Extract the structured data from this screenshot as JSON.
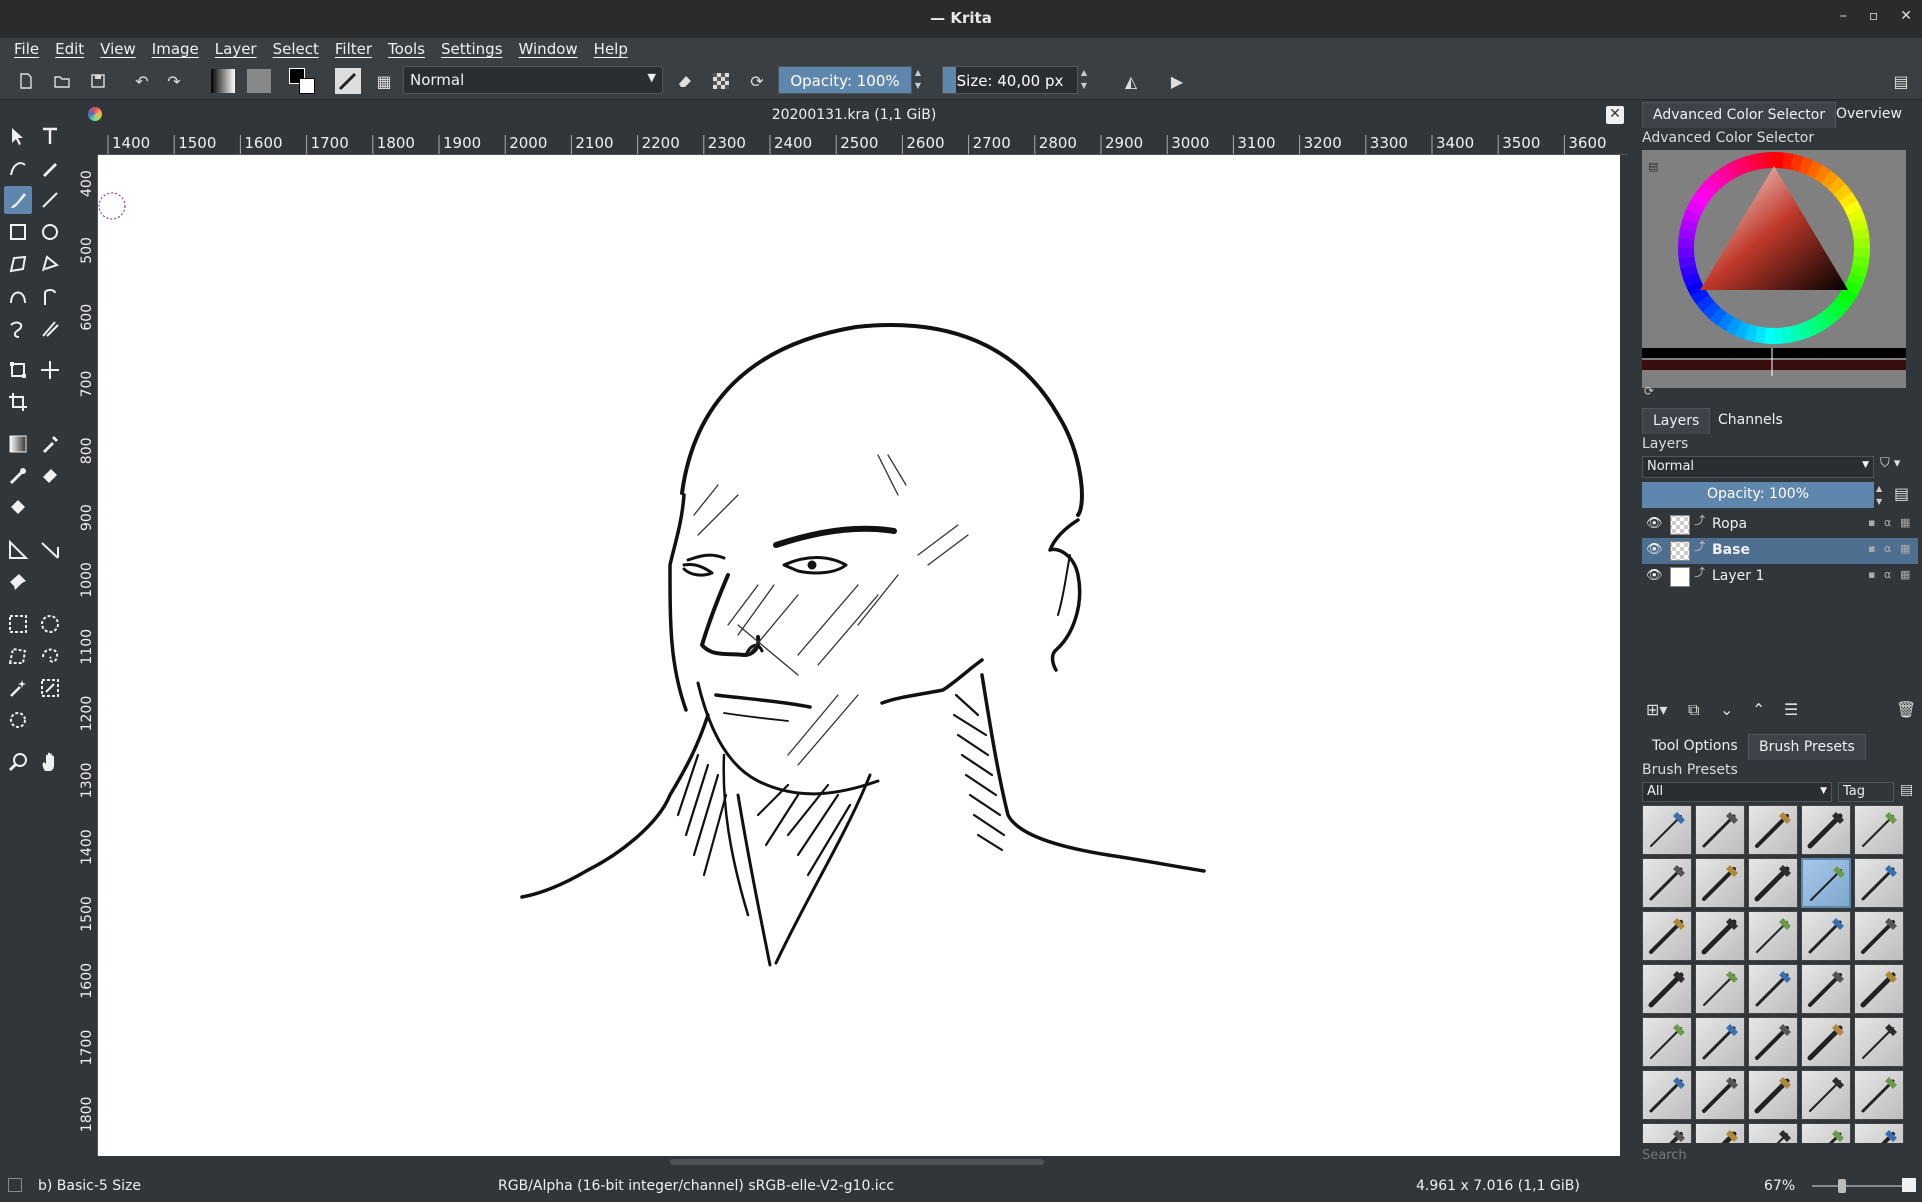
{
  "window": {
    "title": "— Krita"
  },
  "menu": [
    "File",
    "Edit",
    "View",
    "Image",
    "Layer",
    "Select",
    "Filter",
    "Tools",
    "Settings",
    "Window",
    "Help"
  ],
  "toolbar": {
    "blend_mode": "Normal",
    "opacity_label": "Opacity: 100%",
    "opacity_fraction": 1.0,
    "size_label": "Size: 40,00 px",
    "size_fraction": 0.1
  },
  "document": {
    "tab_title": "20200131.kra (1,1 GiB)"
  },
  "rulers": {
    "top": [
      "1400",
      "1500",
      "1600",
      "1700",
      "1800",
      "1900",
      "2000",
      "2100",
      "2200",
      "2300",
      "2400",
      "2500",
      "2600",
      "2700",
      "2800",
      "2900",
      "3000",
      "3100",
      "3200",
      "3300",
      "3400",
      "3500",
      "3600"
    ],
    "left": [
      "400",
      "500",
      "600",
      "700",
      "800",
      "900",
      "1000",
      "1100",
      "1200",
      "1300",
      "1400",
      "1500",
      "1600",
      "1700",
      "1800"
    ]
  },
  "dock": {
    "color_tabs": [
      "Advanced Color Selector",
      "Overview"
    ],
    "color_title": "Advanced Color Selector",
    "layers_tabs": [
      "Layers",
      "Channels"
    ],
    "layers_title": "Layers",
    "layers_blend": "Normal",
    "layers_opacity": "Opacity:  100%",
    "layers": [
      {
        "name": "Ropa"
      },
      {
        "name": "Base"
      },
      {
        "name": "Layer 1"
      }
    ],
    "bottom_tabs": [
      "Tool Options",
      "Brush Presets"
    ],
    "presets_title": "Brush Presets",
    "presets_filter": "All",
    "presets_tag": "Tag",
    "presets_search": "Search"
  },
  "status": {
    "preset": "b) Basic-5 Size",
    "color_info": "RGB/Alpha (16-bit integer/channel)  sRGB-elle-V2-g10.icc",
    "dimensions": "4.961 x 7.016 (1,1 GiB)",
    "zoom": "67%"
  },
  "colors": {
    "accent": "#5f87ae",
    "panel": "#31363b",
    "selected_layer": "#4e6f90"
  }
}
